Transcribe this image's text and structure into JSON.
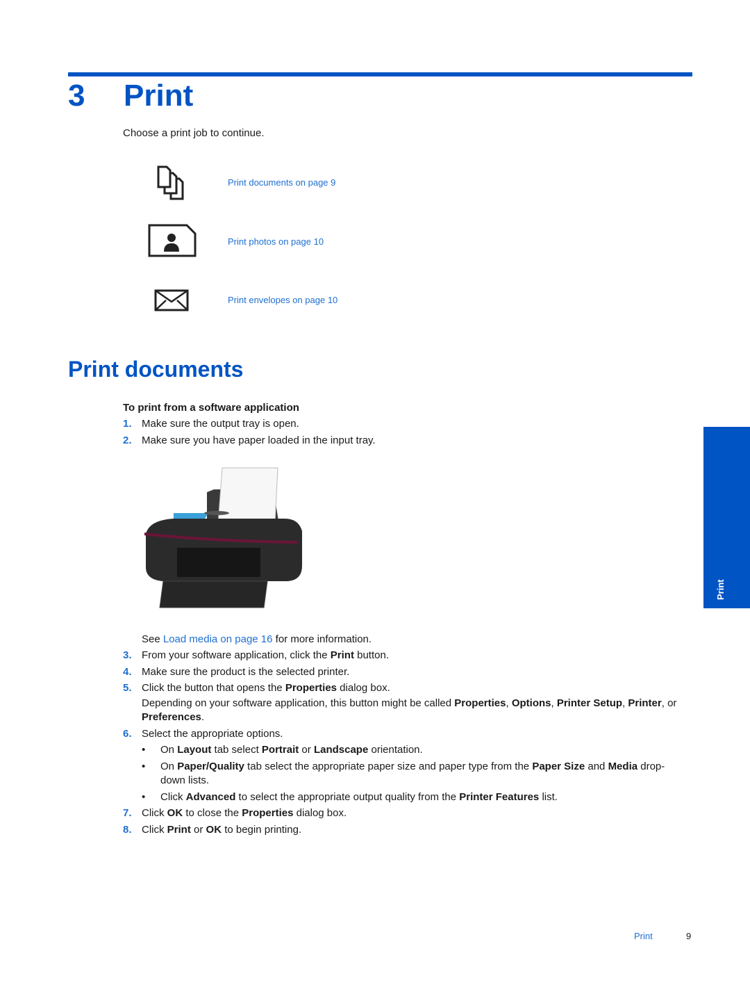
{
  "chapter": {
    "number": "3",
    "title": "Print"
  },
  "intro": "Choose a print job to continue.",
  "print_jobs": [
    {
      "icon": "documents-icon",
      "label": "Print documents on page 9"
    },
    {
      "icon": "photo-icon",
      "label": "Print photos on page 10"
    },
    {
      "icon": "envelope-icon",
      "label": "Print envelopes on page 10"
    }
  ],
  "section": {
    "title": "Print documents",
    "procedure_title": "To print from a software application",
    "steps": [
      {
        "n": "1.",
        "text": "Make sure the output tray is open."
      },
      {
        "n": "2.",
        "text": "Make sure you have paper loaded in the input tray."
      },
      {
        "n": "3.",
        "pre": "From your software application, click the ",
        "b1": "Print",
        "post": " button."
      },
      {
        "n": "4.",
        "text": "Make sure the product is the selected printer."
      },
      {
        "n": "5.",
        "pre": "Click the button that opens the ",
        "b1": "Properties",
        "post": " dialog box."
      },
      {
        "n": "6.",
        "text": "Select the appropriate options."
      },
      {
        "n": "7.",
        "pre": "Click ",
        "b1": "OK",
        "mid": " to close the ",
        "b2": "Properties",
        "post": " dialog box."
      },
      {
        "n": "8.",
        "pre": "Click ",
        "b1": "Print",
        "mid": " or ",
        "b2": "OK",
        "post": " to begin printing."
      }
    ],
    "see_also": {
      "pre": "See ",
      "link": "Load media on page 16",
      "post": " for more information."
    },
    "step5_note": {
      "pre": "Depending on your software application, this button might be called ",
      "b1": "Properties",
      "s1": ", ",
      "b2": "Options",
      "s2": ", ",
      "b3": "Printer Setup",
      "s3": ", ",
      "b4": "Printer",
      "s4": ", or ",
      "b5": "Preferences",
      "post": "."
    },
    "bullets": [
      {
        "pre": "On ",
        "b1": "Layout",
        "m1": " tab select ",
        "b2": "Portrait",
        "m2": " or ",
        "b3": "Landscape",
        "post": " orientation."
      },
      {
        "pre": "On ",
        "b1": "Paper/Quality",
        "m1": " tab select the appropriate paper size and paper type from the ",
        "b2": "Paper Size",
        "m2": " and ",
        "b3": "Media",
        "post": " drop-down lists."
      },
      {
        "pre": "Click ",
        "b1": "Advanced",
        "m1": " to select the appropriate output quality from the ",
        "b2": "Printer Features",
        "post": " list."
      }
    ],
    "bullet_char": "•"
  },
  "side_tab": "Print",
  "footer": {
    "section": "Print",
    "page": "9"
  },
  "colors": {
    "accent": "#0054c4",
    "link": "#1f6fd1"
  }
}
